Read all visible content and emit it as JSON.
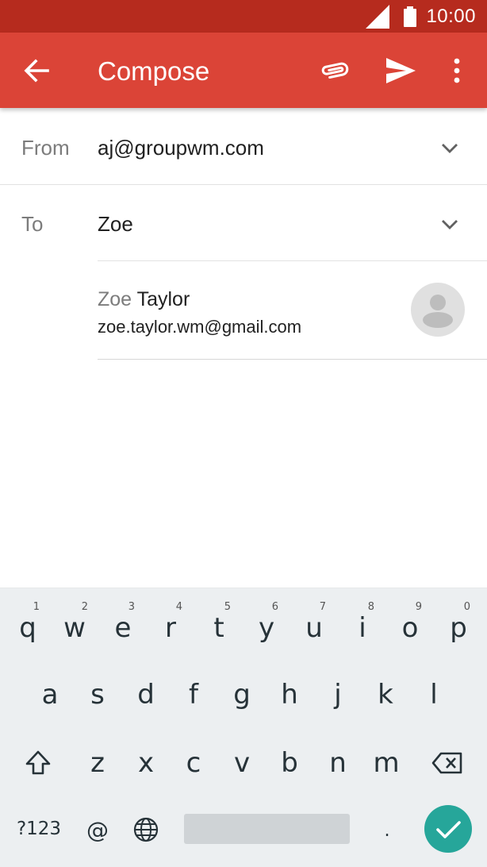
{
  "status_bar": {
    "time": "10:00"
  },
  "app_bar": {
    "title": "Compose"
  },
  "compose": {
    "from_label": "From",
    "from_value": "aj@groupwm.com",
    "to_label": "To",
    "to_value": "Zoe"
  },
  "suggestion": {
    "name_match": "Zoe",
    "name_rest": " Taylor",
    "email": "zoe.taylor.wm@gmail.com"
  },
  "keyboard": {
    "row1": [
      "q",
      "w",
      "e",
      "r",
      "t",
      "y",
      "u",
      "i",
      "o",
      "p"
    ],
    "row1_hints": [
      "1",
      "2",
      "3",
      "4",
      "5",
      "6",
      "7",
      "8",
      "9",
      "0"
    ],
    "row2": [
      "a",
      "s",
      "d",
      "f",
      "g",
      "h",
      "j",
      "k",
      "l"
    ],
    "row3": [
      "z",
      "x",
      "c",
      "v",
      "b",
      "n",
      "m"
    ],
    "symbols_label": "?123",
    "at_label": "@",
    "period_label": "."
  },
  "colors": {
    "status_bar": "#b62b1e",
    "app_bar": "#db4437",
    "enter_key": "#26a69a",
    "keyboard_bg": "#eceff1"
  }
}
